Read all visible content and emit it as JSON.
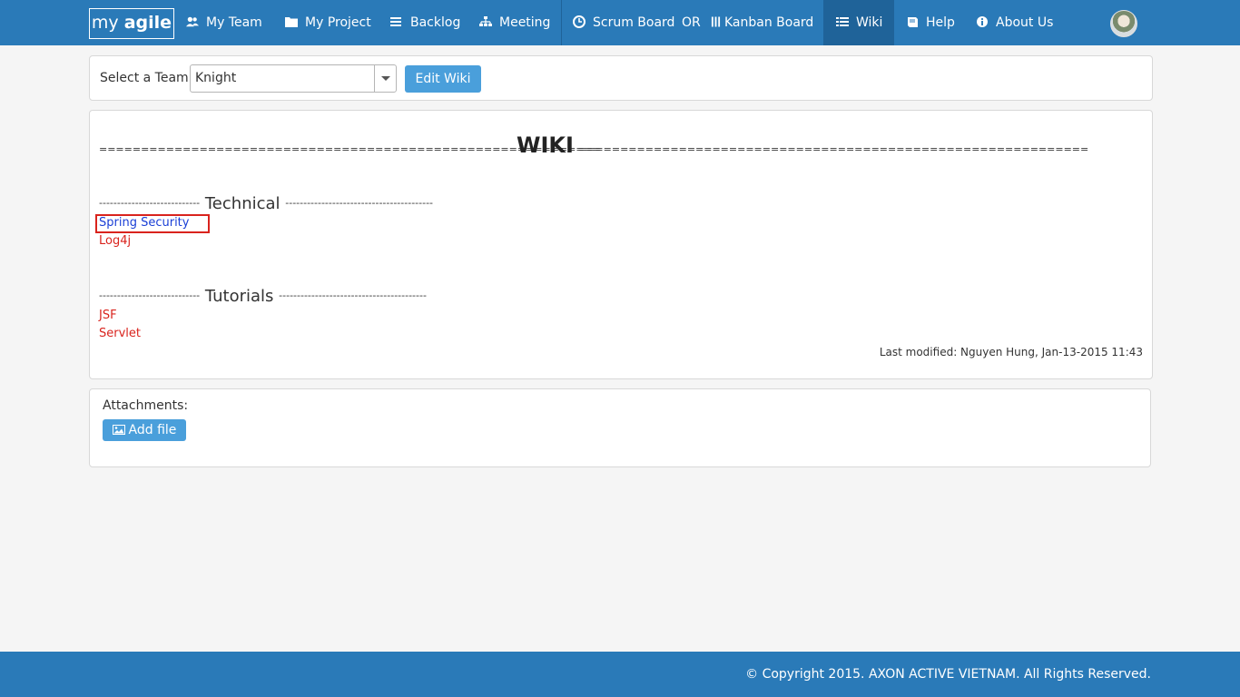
{
  "navbar": {
    "brand_prefix": "my ",
    "brand_bold": "agile",
    "items": [
      {
        "label": "My Team",
        "icon": "users-icon"
      },
      {
        "label": "My Project",
        "icon": "folder-icon"
      },
      {
        "label": "Backlog",
        "icon": "list-icon"
      },
      {
        "label": "Meeting",
        "icon": "sitemap-icon"
      },
      {
        "label": "Scrum Board",
        "icon": "clock-icon"
      },
      {
        "label": "OR"
      },
      {
        "label": "Kanban Board",
        "icon": "columns-icon"
      },
      {
        "label": "Wiki",
        "icon": "table-list-icon",
        "active": true
      },
      {
        "label": "Help",
        "icon": "book-icon"
      },
      {
        "label": "About Us",
        "icon": "info-icon"
      }
    ],
    "avatar": "user-avatar"
  },
  "team_select": {
    "label": "Select a Team:",
    "value": "Knight",
    "edit_button": "Edit Wiki"
  },
  "wiki": {
    "title": "WIKI",
    "eq_left": "============================================================",
    "eq_right": "=============================================================",
    "sections": [
      {
        "dash_left": "----------------------------",
        "title": "Technical",
        "dash_right": "-----------------------------------------",
        "links": [
          "Spring Security",
          "Log4j"
        ]
      },
      {
        "dash_left": "----------------------------",
        "title": "Tutorials",
        "dash_right": "-----------------------------------------",
        "links": [
          "JSF",
          "Servlet"
        ]
      }
    ],
    "last_modified": "Last modified: Nguyen Hung, Jan-13-2015 11:43"
  },
  "attachments": {
    "label": "Attachments:",
    "add_button": "Add file"
  },
  "footer": {
    "copyright": "© Copyright 2015. AXON ACTIVE VIETNAM. All Rights Reserved."
  },
  "colors": {
    "navbar": "#2a7ab8",
    "active_nav": "#1f6399",
    "button": "#4a9fdb",
    "link_red": "#d9231d",
    "link_blue": "#1a3fd6"
  }
}
